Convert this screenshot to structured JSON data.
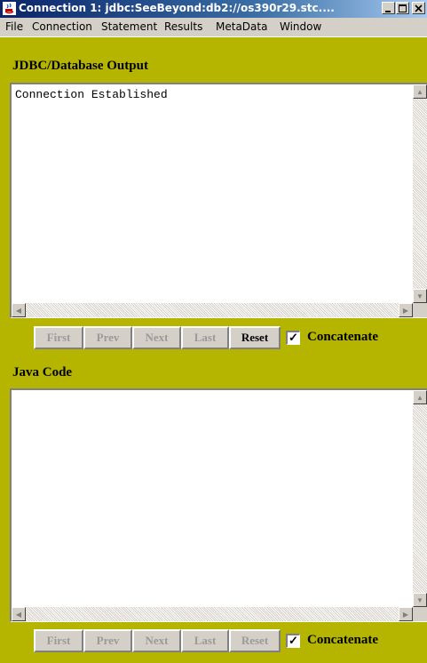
{
  "window": {
    "title": "Connection 1: jdbc:SeeBeyond:db2://os390r29.stc....",
    "controls": [
      "minimize",
      "maximize",
      "close"
    ]
  },
  "menu": [
    "File",
    "Connection",
    "Statement",
    "Results",
    "MetaData",
    "Window"
  ],
  "output_section": {
    "label": "JDBC/Database Output",
    "text": "Connection Established"
  },
  "output_buttons": {
    "first": "First",
    "prev": "Prev",
    "next": "Next",
    "last": "Last",
    "reset": "Reset",
    "concatenate": "Concatenate",
    "concatenate_checked": true
  },
  "java_section": {
    "label": "Java Code",
    "text": ""
  },
  "java_buttons": {
    "first": "First",
    "prev": "Prev",
    "next": "Next",
    "last": "Last",
    "reset": "Reset",
    "concatenate": "Concatenate",
    "concatenate_checked": true
  },
  "colors": {
    "panel_bg": "#b5b500",
    "titlebar": "#0a246a",
    "chrome": "#d4d0c8"
  }
}
